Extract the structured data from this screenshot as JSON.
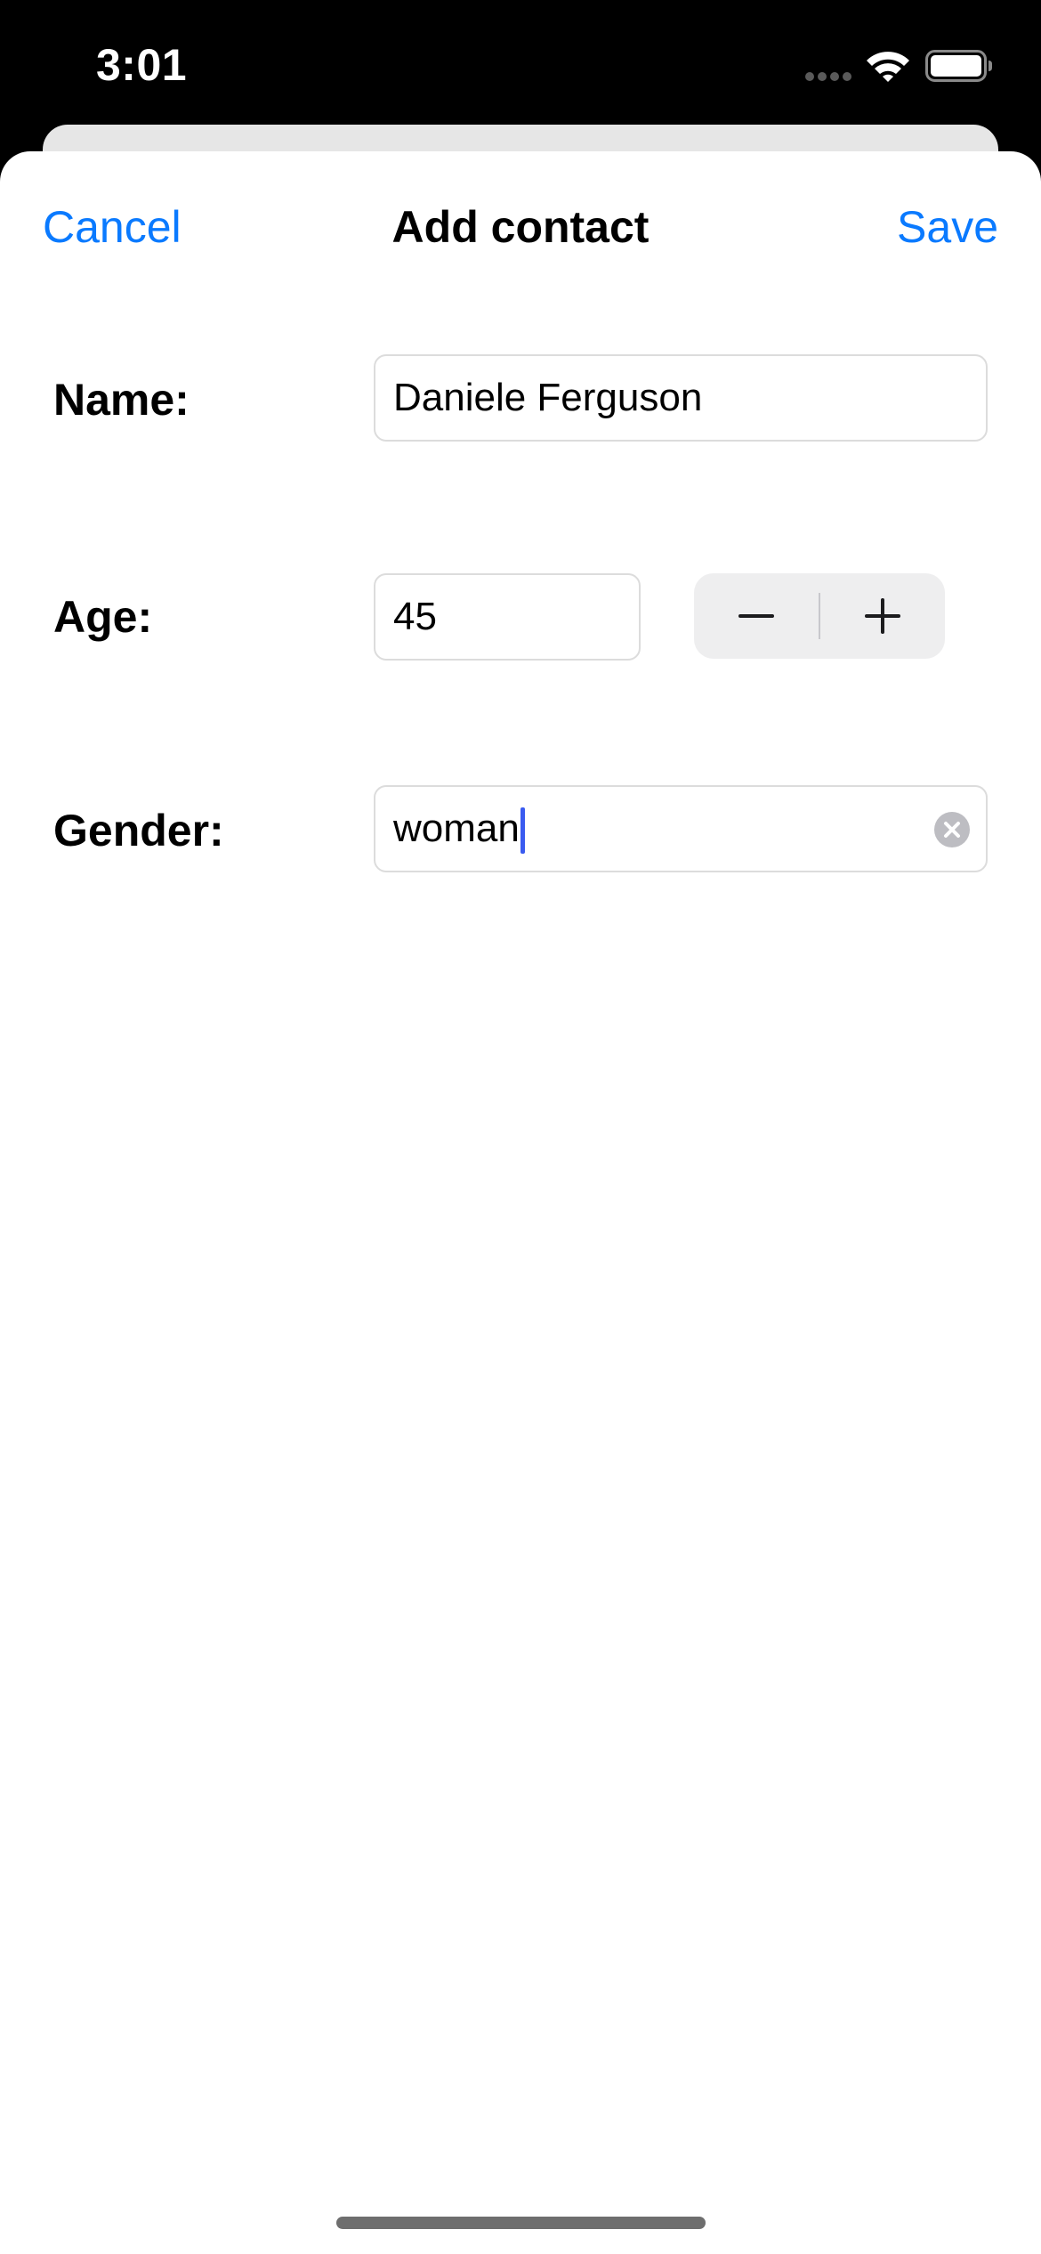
{
  "status_bar": {
    "time": "3:01"
  },
  "nav": {
    "cancel_label": "Cancel",
    "title": "Add contact",
    "save_label": "Save"
  },
  "form": {
    "name": {
      "label": "Name:",
      "value": "Daniele Ferguson"
    },
    "age": {
      "label": "Age:",
      "value": "45"
    },
    "gender": {
      "label": "Gender:",
      "value": "woman"
    }
  },
  "colors": {
    "accent": "#0a7aff",
    "cursor": "#3a5bf0",
    "background": "#ffffff",
    "field_border": "#dcdcdc",
    "stepper_bg": "#eeeeef"
  },
  "icons": {
    "signal": "cellular-signal-icon",
    "wifi": "wifi-icon",
    "battery": "battery-icon",
    "minus": "minus-icon",
    "plus": "plus-icon",
    "clear": "clear-circle-x-icon"
  }
}
